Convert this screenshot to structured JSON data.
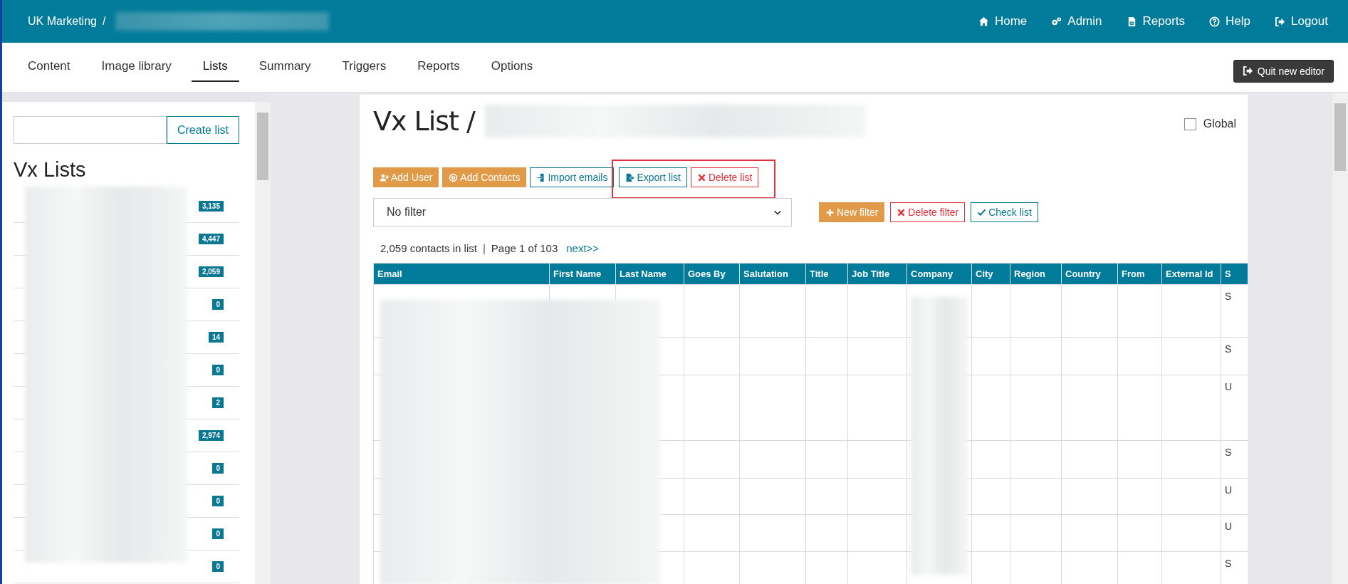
{
  "header": {
    "breadcrumb": "UK Marketing",
    "separator": "/",
    "nav": [
      {
        "kind": "home",
        "label": "Home"
      },
      {
        "kind": "gears",
        "label": "Admin"
      },
      {
        "kind": "report",
        "label": "Reports"
      },
      {
        "kind": "help",
        "label": "Help"
      },
      {
        "kind": "logout",
        "label": "Logout"
      }
    ]
  },
  "tabs": [
    {
      "label": "Content",
      "selected": false
    },
    {
      "label": "Image library",
      "selected": false
    },
    {
      "label": "Lists",
      "selected": true
    },
    {
      "label": "Summary",
      "selected": false
    },
    {
      "label": "Triggers",
      "selected": false
    },
    {
      "label": "Reports",
      "selected": false
    },
    {
      "label": "Options",
      "selected": false
    }
  ],
  "quit_button": "Quit new editor",
  "sidebar": {
    "create_button": "Create list",
    "heading": "Vx Lists",
    "items": [
      {
        "count": "3,135"
      },
      {
        "count": "4,447"
      },
      {
        "count": "2,059"
      },
      {
        "count": "0"
      },
      {
        "count": "14"
      },
      {
        "count": "0"
      },
      {
        "count": "2"
      },
      {
        "count": "2,974"
      },
      {
        "count": "0"
      },
      {
        "count": "0"
      },
      {
        "count": "0"
      },
      {
        "count": "0"
      }
    ]
  },
  "main": {
    "title": "Vx List /",
    "global": {
      "label": "Global",
      "checked": false
    },
    "actions": [
      {
        "kind": "add-user",
        "label": "Add User",
        "highlighted": false
      },
      {
        "kind": "at",
        "label": "Add Contacts",
        "highlighted": false
      },
      {
        "kind": "import",
        "label": "Import emails",
        "highlighted": false
      },
      {
        "kind": "export",
        "label": "Export list",
        "highlighted": true
      },
      {
        "kind": "delete",
        "label": "Delete list",
        "highlighted": true
      }
    ],
    "filter": {
      "value": "No filter"
    },
    "filter_actions": [
      {
        "kind": "plus",
        "label": "New filter"
      },
      {
        "kind": "delete",
        "label": "Delete filter"
      },
      {
        "kind": "check",
        "label": "Check list"
      }
    ],
    "summary": "2,059 contacts in list",
    "separator": "|",
    "page": "Page 1 of 103",
    "next": "next>>",
    "table": {
      "columns": [
        "Email",
        "First Name",
        "Last Name",
        "Goes By",
        "Salutation",
        "Title",
        "Job Title",
        "Company",
        "City",
        "Region",
        "Country",
        "From",
        "External Id",
        "S"
      ],
      "rows": [
        {
          "column_14": "S"
        },
        {
          "column_14": "S"
        },
        {
          "column_14": "U"
        },
        {
          "column_14": "S"
        },
        {
          "column_14": "U"
        },
        {
          "column_14": "U"
        },
        {
          "column_14": "S"
        }
      ]
    }
  }
}
